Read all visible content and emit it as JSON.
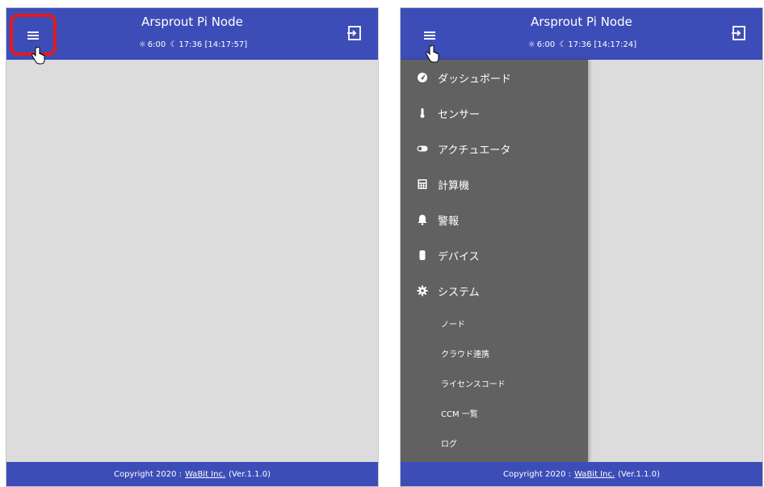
{
  "app": {
    "title": "Arsprout Pi Node",
    "sunrise": "6:00",
    "sunset": "17:36"
  },
  "left_panel": {
    "clock": "[14:17:57]"
  },
  "right_panel": {
    "clock": "[14:17:24]"
  },
  "footer": {
    "copyright": "Copyright 2020 :",
    "company": "WaBit Inc.",
    "version": "(Ver.1.1.0)"
  },
  "drawer": {
    "items": [
      {
        "label": "ダッシュボード",
        "icon": "dashboard-icon"
      },
      {
        "label": "センサー",
        "icon": "thermometer-icon"
      },
      {
        "label": "アクチュエータ",
        "icon": "toggle-icon"
      },
      {
        "label": "計算機",
        "icon": "calculator-icon"
      },
      {
        "label": "警報",
        "icon": "bell-icon"
      },
      {
        "label": "デバイス",
        "icon": "device-icon"
      },
      {
        "label": "システム",
        "icon": "gear-icon"
      }
    ],
    "sub_items": [
      {
        "label": "ノード"
      },
      {
        "label": "クラウド連携"
      },
      {
        "label": "ライセンスコード"
      },
      {
        "label": "CCM 一覧"
      },
      {
        "label": "ログ"
      }
    ]
  },
  "colors": {
    "header": "#3d4db7",
    "content": "#dcdcdc",
    "drawer": "#616161",
    "highlight": "#e21b1b"
  }
}
